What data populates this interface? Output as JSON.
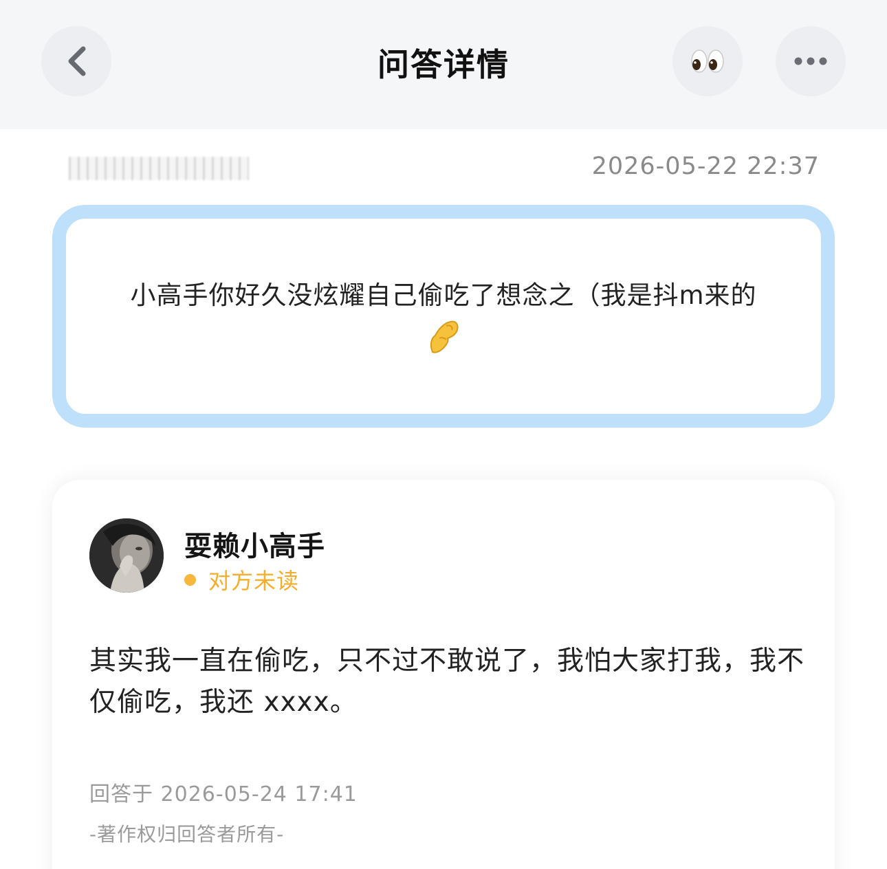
{
  "header": {
    "title": "问答详情",
    "back_icon": "chevron-left-icon",
    "eyes_icon": "eyes-emoji-icon",
    "more_icon": "more-dots-icon"
  },
  "question": {
    "asker_name": "",
    "time": "2026-05-22 22:37",
    "text": "小高手你好久没炫耀自己偷吃了想念之（我是抖m来的",
    "emoji_icon": "pinched-fingers-icon",
    "card_border_color": "#bfe0fb"
  },
  "answer": {
    "answerer_name": "耍赖小高手",
    "status_text": "对方未读",
    "status_color": "#f5ad2a",
    "text": "其实我一直在偷吃，只不过不敢说了，我怕大家打我，我不仅偷吃，我还 xxxx。",
    "time": "回答于 2026-05-24 17:41",
    "copyright": "-著作权归回答者所有-"
  }
}
